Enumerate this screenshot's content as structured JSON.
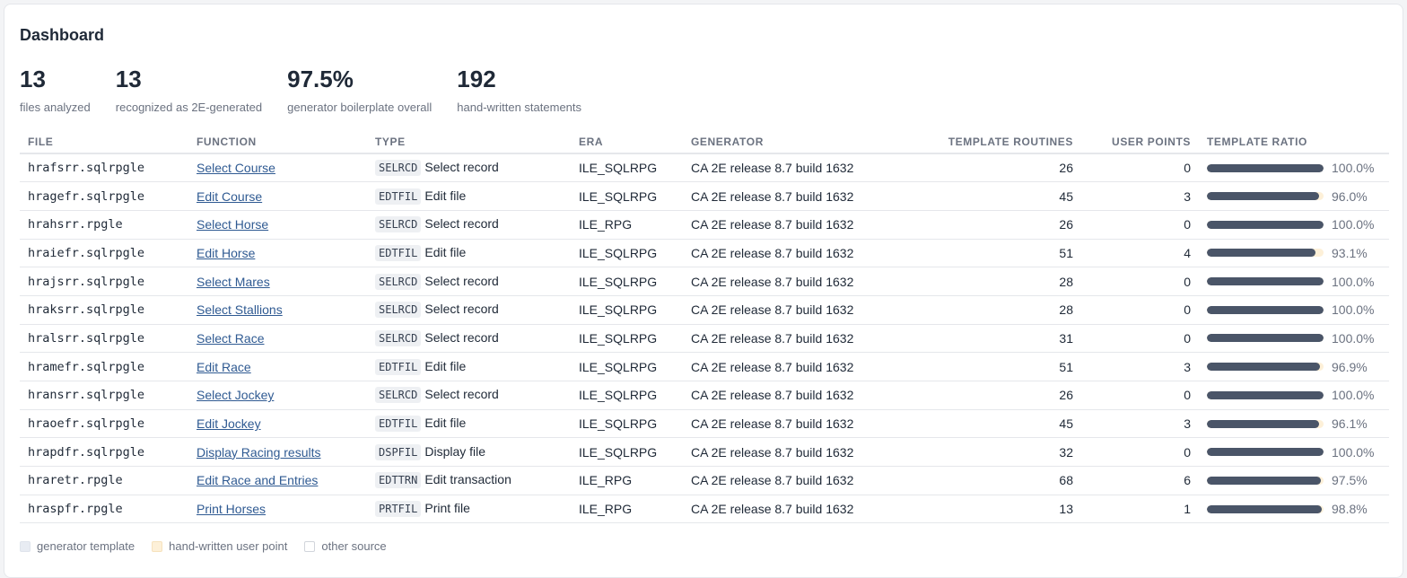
{
  "header": {
    "title": "Dashboard"
  },
  "stats": [
    {
      "value": "13",
      "label": "files analyzed"
    },
    {
      "value": "13",
      "label": "recognized as 2E-generated"
    },
    {
      "value": "97.5%",
      "label": "generator boilerplate overall"
    },
    {
      "value": "192",
      "label": "hand-written statements"
    }
  ],
  "table": {
    "columns": [
      "FILE",
      "FUNCTION",
      "TYPE",
      "ERA",
      "GENERATOR",
      "TEMPLATE ROUTINES",
      "USER POINTS",
      "TEMPLATE RATIO"
    ],
    "rows": [
      {
        "file": "hrafsrr.sqlrpgle",
        "function": "Select Course",
        "type_code": "SELRCD",
        "type_label": "Select record",
        "era": "ILE_SQLRPG",
        "generator": "CA 2E release 8.7 build 1632",
        "template_routines": "26",
        "user_points": "0",
        "ratio_text": "100.0%",
        "ratio": 1.0
      },
      {
        "file": "hragefr.sqlrpgle",
        "function": "Edit Course",
        "type_code": "EDTFIL",
        "type_label": "Edit file",
        "era": "ILE_SQLRPG",
        "generator": "CA 2E release 8.7 build 1632",
        "template_routines": "45",
        "user_points": "3",
        "ratio_text": "96.0%",
        "ratio": 0.96
      },
      {
        "file": "hrahsrr.rpgle",
        "function": "Select Horse",
        "type_code": "SELRCD",
        "type_label": "Select record",
        "era": "ILE_RPG",
        "generator": "CA 2E release 8.7 build 1632",
        "template_routines": "26",
        "user_points": "0",
        "ratio_text": "100.0%",
        "ratio": 1.0
      },
      {
        "file": "hraiefr.sqlrpgle",
        "function": "Edit Horse",
        "type_code": "EDTFIL",
        "type_label": "Edit file",
        "era": "ILE_SQLRPG",
        "generator": "CA 2E release 8.7 build 1632",
        "template_routines": "51",
        "user_points": "4",
        "ratio_text": "93.1%",
        "ratio": 0.931
      },
      {
        "file": "hrajsrr.sqlrpgle",
        "function": "Select Mares",
        "type_code": "SELRCD",
        "type_label": "Select record",
        "era": "ILE_SQLRPG",
        "generator": "CA 2E release 8.7 build 1632",
        "template_routines": "28",
        "user_points": "0",
        "ratio_text": "100.0%",
        "ratio": 1.0
      },
      {
        "file": "hraksrr.sqlrpgle",
        "function": "Select Stallions",
        "type_code": "SELRCD",
        "type_label": "Select record",
        "era": "ILE_SQLRPG",
        "generator": "CA 2E release 8.7 build 1632",
        "template_routines": "28",
        "user_points": "0",
        "ratio_text": "100.0%",
        "ratio": 1.0
      },
      {
        "file": "hralsrr.sqlrpgle",
        "function": "Select Race",
        "type_code": "SELRCD",
        "type_label": "Select record",
        "era": "ILE_SQLRPG",
        "generator": "CA 2E release 8.7 build 1632",
        "template_routines": "31",
        "user_points": "0",
        "ratio_text": "100.0%",
        "ratio": 1.0
      },
      {
        "file": "hramefr.sqlrpgle",
        "function": "Edit Race",
        "type_code": "EDTFIL",
        "type_label": "Edit file",
        "era": "ILE_SQLRPG",
        "generator": "CA 2E release 8.7 build 1632",
        "template_routines": "51",
        "user_points": "3",
        "ratio_text": "96.9%",
        "ratio": 0.969
      },
      {
        "file": "hransrr.sqlrpgle",
        "function": "Select Jockey",
        "type_code": "SELRCD",
        "type_label": "Select record",
        "era": "ILE_SQLRPG",
        "generator": "CA 2E release 8.7 build 1632",
        "template_routines": "26",
        "user_points": "0",
        "ratio_text": "100.0%",
        "ratio": 1.0
      },
      {
        "file": "hraoefr.sqlrpgle",
        "function": "Edit Jockey",
        "type_code": "EDTFIL",
        "type_label": "Edit file",
        "era": "ILE_SQLRPG",
        "generator": "CA 2E release 8.7 build 1632",
        "template_routines": "45",
        "user_points": "3",
        "ratio_text": "96.1%",
        "ratio": 0.961
      },
      {
        "file": "hrapdfr.sqlrpgle",
        "function": "Display Racing results",
        "type_code": "DSPFIL",
        "type_label": "Display file",
        "era": "ILE_SQLRPG",
        "generator": "CA 2E release 8.7 build 1632",
        "template_routines": "32",
        "user_points": "0",
        "ratio_text": "100.0%",
        "ratio": 1.0
      },
      {
        "file": "hraretr.rpgle",
        "function": "Edit Race and Entries",
        "type_code": "EDTTRN",
        "type_label": "Edit transaction",
        "era": "ILE_RPG",
        "generator": "CA 2E release 8.7 build 1632",
        "template_routines": "68",
        "user_points": "6",
        "ratio_text": "97.5%",
        "ratio": 0.975
      },
      {
        "file": "hraspfr.rpgle",
        "function": "Print Horses",
        "type_code": "PRTFIL",
        "type_label": "Print file",
        "era": "ILE_RPG",
        "generator": "CA 2E release 8.7 build 1632",
        "template_routines": "13",
        "user_points": "1",
        "ratio_text": "98.8%",
        "ratio": 0.988
      }
    ]
  },
  "legend": [
    {
      "label": "generator template",
      "color": "#e8ecf3",
      "border": "#dfe4ec"
    },
    {
      "label": "hand-written user point",
      "color": "#fdf0d8",
      "border": "#f6e2bd"
    },
    {
      "label": "other source",
      "color": "#ffffff",
      "border": "#d1d5db"
    }
  ],
  "colors": {
    "bar_template": "#4a5568",
    "bar_user": "#fdf0d8",
    "link": "#2f5a92"
  }
}
